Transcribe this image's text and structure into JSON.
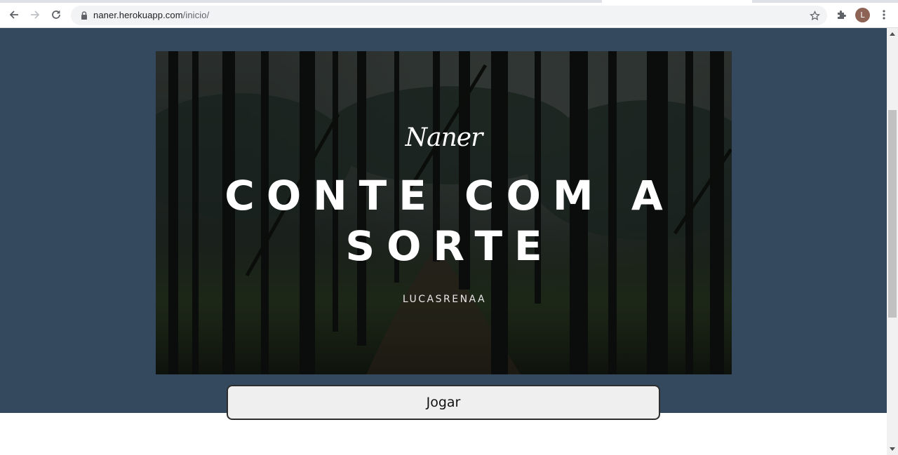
{
  "browser": {
    "url_host": "naner.herokuapp.com",
    "url_path": "/inicio/",
    "profile_initial": "L"
  },
  "hero": {
    "brand": "Naner",
    "title_line1": "CONTE COM A",
    "title_line2": "SORTE",
    "author": "LUCASRENAA"
  },
  "actions": {
    "play_label": "Jogar"
  },
  "colors": {
    "page_background": "#34495e",
    "button_background": "#efefef"
  }
}
